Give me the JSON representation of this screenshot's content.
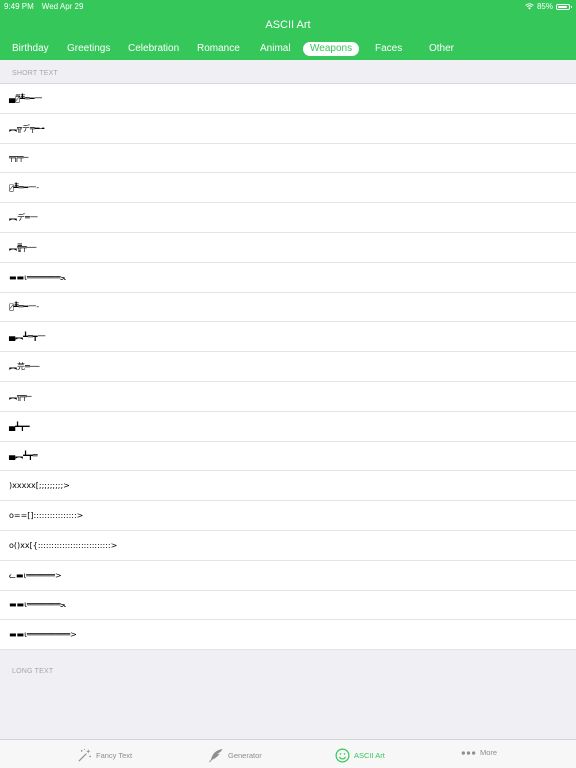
{
  "status_bar": {
    "time": "9:49 PM",
    "date": "Wed Apr 29",
    "battery": "85%",
    "battery_level": 0.85
  },
  "app_title": "ASCII Art",
  "tabs": [
    {
      "label": "Birthday",
      "active": false
    },
    {
      "label": "Greetings",
      "active": false
    },
    {
      "label": "Celebration",
      "active": false
    },
    {
      "label": "Romance",
      "active": false
    },
    {
      "label": "Animal",
      "active": false
    },
    {
      "label": "Weapons",
      "active": true
    },
    {
      "label": "Faces",
      "active": false
    },
    {
      "label": "Other",
      "active": false
    }
  ],
  "sections": {
    "short": "SHORT TEXT",
    "long": "LONG TEXT"
  },
  "short_items": [
    "▄︻̷̿┻̿═━一",
    "︻╦デ╤━╼",
    "╤╦╤─",
    "︻̷┻̿═━一-",
    "︻デ═一",
    "︻╦̵̵͇̿̿̿̿╤──",
    "▬▬ι═══════ﺤ",
    "︻̷┻̿═━一-",
    "▄︻┻═┳一",
    "︻芫═──",
    "︻╦╤─",
    "▄┻┳━",
    "▄︻┻┳═",
    ")xxxxx[;;;;;;;;;>",
    "o==[]::::::::::::::::>",
    "o()xx[{:::::::::::::::::::::::::::>",
    "ᓚ▬ι══════>",
    "▬▬ι═══════ﺤ",
    "▬▬ι═════════>"
  ],
  "tabbar": [
    {
      "label": "Fancy Text",
      "icon": "magic-wand-icon",
      "active": false
    },
    {
      "label": "Generator",
      "icon": "feather-icon",
      "active": false
    },
    {
      "label": "ASCII Art",
      "icon": "smiley-icon",
      "active": true
    },
    {
      "label": "More",
      "icon": "more-dots-icon",
      "active": false
    }
  ],
  "colors": {
    "accent": "#36c75a",
    "background": "#efeff4",
    "separator": "#e4e4e8",
    "tabbar_inactive": "#8e8e93"
  }
}
